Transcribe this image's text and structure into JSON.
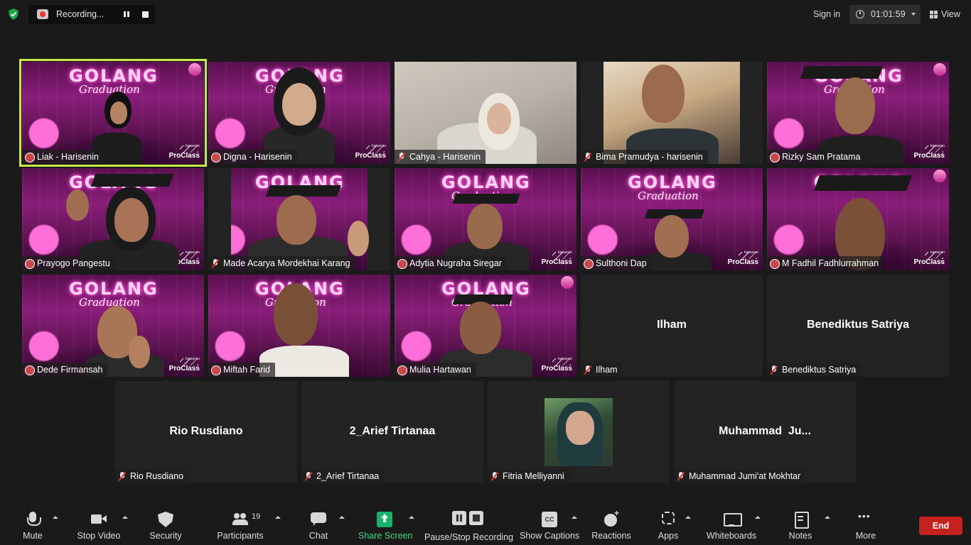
{
  "topbar": {
    "recording_text": "Recording...",
    "signin_label": "Sign in",
    "timer": "01:01:59",
    "view_label": "View"
  },
  "background_text": {
    "logo_title": "GOLANG",
    "logo_subtitle": "Graduation",
    "brand_small": "harisenin",
    "brand_big": "ProClass"
  },
  "tiles": [
    {
      "name": "Liak - Harisenin",
      "muted": false
    },
    {
      "name": "Digna - Harisenin",
      "muted": false
    },
    {
      "name": "Cahya - Harisenin",
      "muted": true
    },
    {
      "name": "Bima Pramudya - harisenin",
      "muted": true
    },
    {
      "name": "Rizky Sam Pratama",
      "muted": false
    },
    {
      "name": "Prayogo Pangestu",
      "muted": false
    },
    {
      "name": "Made Acarya Mordekhai Karang",
      "muted": true
    },
    {
      "name": "Adytia Nugraha Siregar",
      "muted": false
    },
    {
      "name": "Sulthoni Dap",
      "muted": false
    },
    {
      "name": "M Fadhil Fadhlurrahman",
      "muted": false
    },
    {
      "name": "Dede Firmansah",
      "muted": false
    },
    {
      "name": "Miftah Farid",
      "muted": false
    },
    {
      "name": "Mulia Hartawan",
      "muted": false
    },
    {
      "name": "Ilham",
      "display": "Ilham",
      "muted": true
    },
    {
      "name": "Benediktus Satriya",
      "display": "Benediktus Satriya",
      "muted": true
    },
    {
      "name": "Rio Rusdiano",
      "display": "Rio Rusdiano",
      "muted": true
    },
    {
      "name": "2_Arief Tirtanaa",
      "display": "2_Arief Tirtanaa",
      "muted": true
    },
    {
      "name": "Fitria Melliyanni",
      "muted": true
    },
    {
      "name": "Muhammad Jumi'at Mokhtar",
      "display": "Muhammad  Ju...",
      "muted": true
    }
  ],
  "toolbar": {
    "mute": "Mute",
    "stop_video": "Stop Video",
    "security": "Security",
    "participants": "Participants",
    "participant_count": "19",
    "chat": "Chat",
    "share_screen": "Share Screen",
    "pause_stop_recording": "Pause/Stop Recording",
    "show_captions": "Show Captions",
    "captions_icon_text": "CC",
    "reactions": "Reactions",
    "apps": "Apps",
    "whiteboards": "Whiteboards",
    "notes": "Notes",
    "more": "More",
    "end": "End"
  },
  "colors": {
    "active_speaker_border": "#c9e84a",
    "share_green": "#17b26a",
    "end_red": "#c5221f",
    "muted_red": "#e02b2b"
  }
}
